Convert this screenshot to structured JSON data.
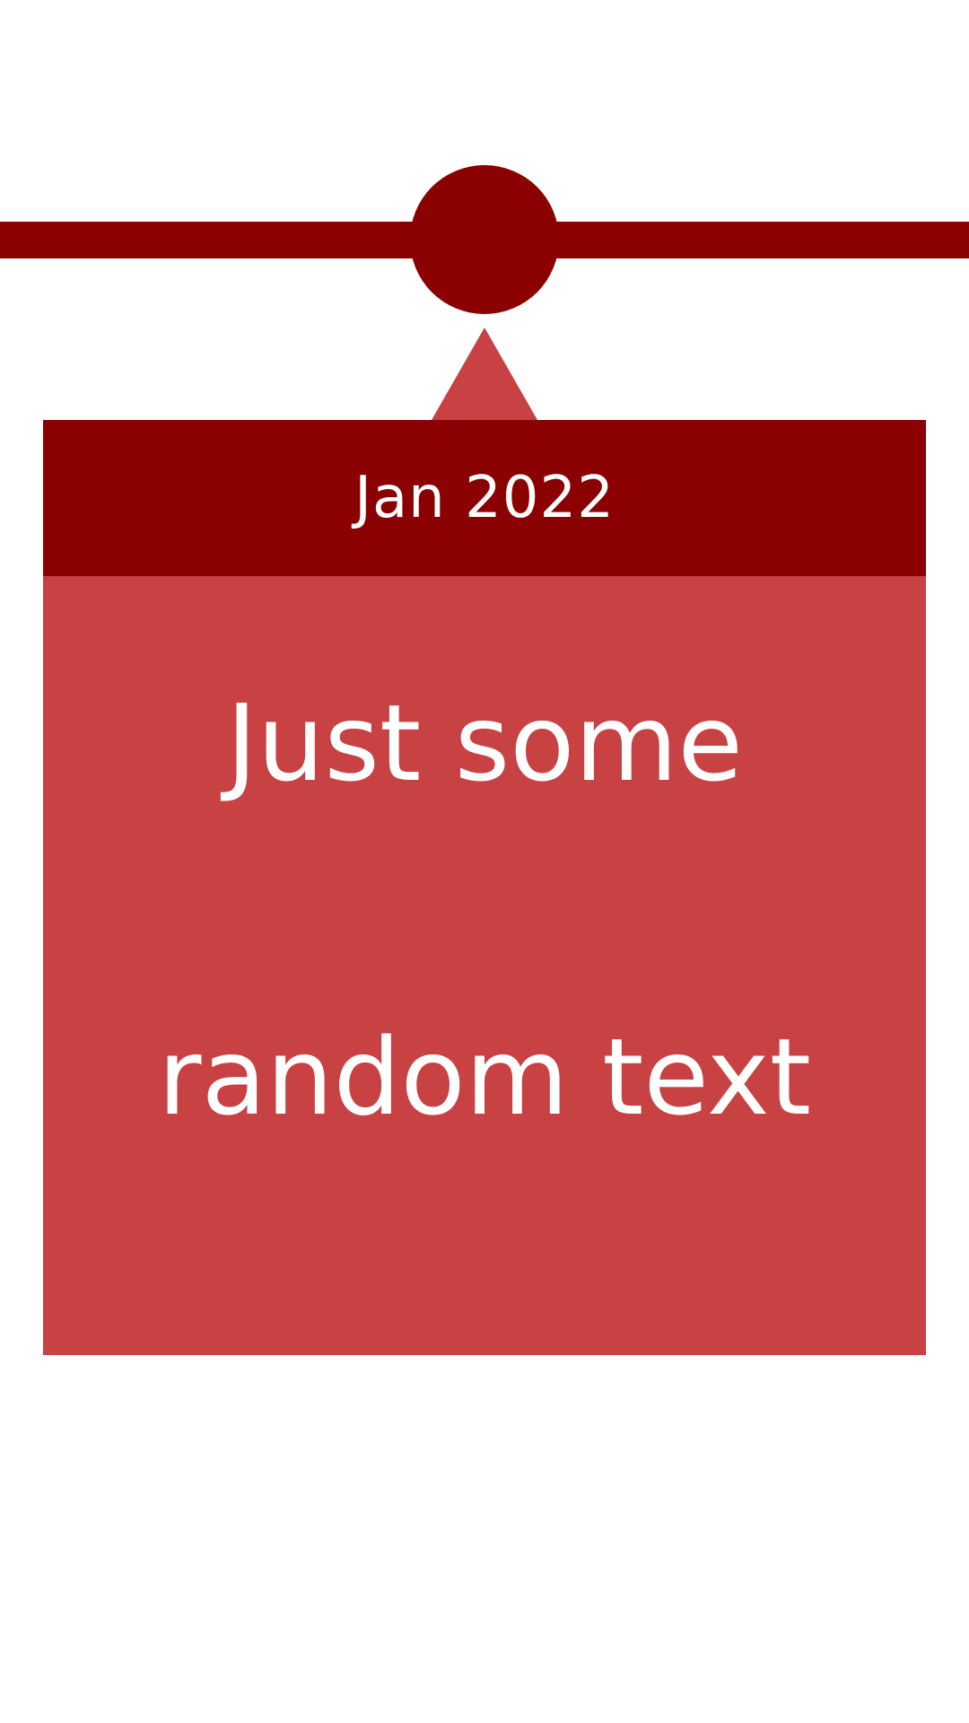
{
  "colors": {
    "dark_red": "#8b0000",
    "light_red": "#c84143",
    "text": "#ffffff"
  },
  "event": {
    "date": "Jan 2022",
    "text": "Just some\nrandom text"
  }
}
